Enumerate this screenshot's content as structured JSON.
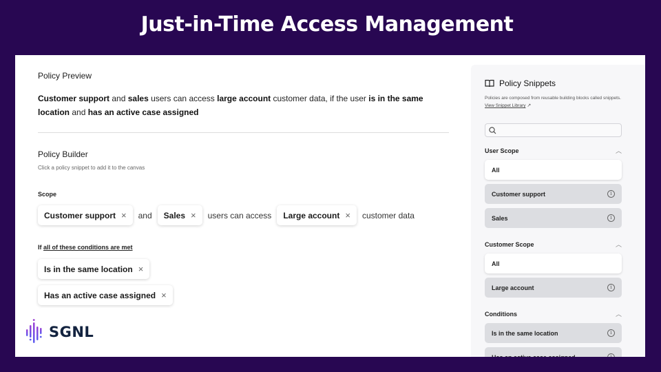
{
  "slide_title": "Just-in-Time Access Management",
  "preview": {
    "heading": "Policy Preview",
    "segments": [
      {
        "text": "Customer support",
        "bold": true
      },
      {
        "text": " and ",
        "bold": false
      },
      {
        "text": "sales",
        "bold": true
      },
      {
        "text": " users can access ",
        "bold": false
      },
      {
        "text": "large account",
        "bold": true
      },
      {
        "text": " customer data, if the user ",
        "bold": false
      },
      {
        "text": "is in the same location",
        "bold": true
      },
      {
        "text": " and ",
        "bold": false
      },
      {
        "text": "has an active case assigned",
        "bold": true
      }
    ]
  },
  "builder": {
    "heading": "Policy Builder",
    "subtitle": "Click a policy snippet to add it to the canvas",
    "scope_label": "Scope",
    "scope_chips": {
      "user1": "Customer support",
      "connector1": "and",
      "user2": "Sales",
      "connector2": "users can access",
      "customer": "Large account",
      "connector3": "customer data"
    },
    "conditions_prefix": "If",
    "conditions_link": "all of these conditions are met",
    "conditions": [
      "Is in the same location",
      "Has an active case assigned"
    ],
    "remove_glyph": "×"
  },
  "logo": {
    "text": "SGNL"
  },
  "sidebar": {
    "title": "Policy Snippets",
    "description": "Policies are composed from reusable building blocks called snippets.",
    "library_link": "View Snippet Library",
    "search_placeholder": "",
    "groups": [
      {
        "title": "User Scope",
        "items": [
          "All",
          "Customer support",
          "Sales"
        ]
      },
      {
        "title": "Customer Scope",
        "items": [
          "All",
          "Large account"
        ]
      },
      {
        "title": "Conditions",
        "items": [
          "Is in the same location",
          "Has an active case assigned"
        ]
      }
    ]
  },
  "colors": {
    "background": "#280752",
    "logo_text": "#13233f",
    "logo_gradient_top": "#9b3fd4",
    "logo_gradient_bottom": "#5b5cf0",
    "snippet_gray": "#dcdde1",
    "sidebar_bg": "#f7f7f9"
  }
}
